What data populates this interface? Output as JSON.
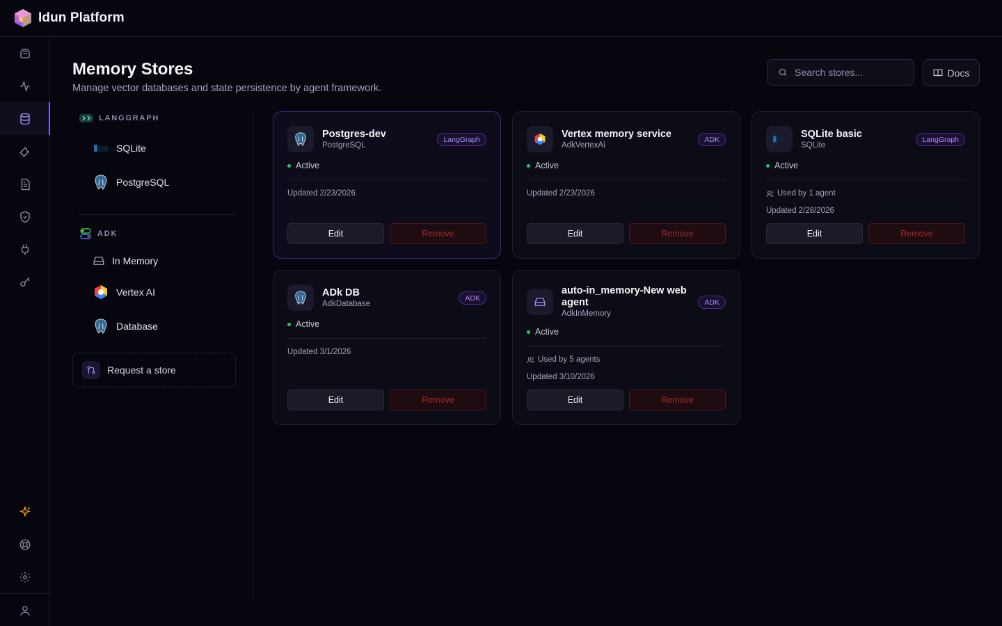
{
  "app": {
    "title": "Idun Platform"
  },
  "rail": {
    "items": [
      {
        "name": "agents-icon"
      },
      {
        "name": "activity-icon"
      },
      {
        "name": "database-icon",
        "active": true
      },
      {
        "name": "wrench-icon"
      },
      {
        "name": "document-icon"
      },
      {
        "name": "shield-icon"
      },
      {
        "name": "plug-icon"
      },
      {
        "name": "key-icon"
      }
    ],
    "bottom": [
      {
        "name": "sparkle-icon"
      },
      {
        "name": "help-icon"
      },
      {
        "name": "settings-icon"
      },
      {
        "name": "user-icon"
      }
    ]
  },
  "page": {
    "title": "Memory Stores",
    "subtitle": "Manage vector databases and state persistence by agent framework."
  },
  "search": {
    "placeholder": "Search stores..."
  },
  "docs": {
    "label": "Docs"
  },
  "frameworks": [
    {
      "label": "LANGGRAPH",
      "icon": "langgraph-icon",
      "items": [
        {
          "label": "SQLite",
          "icon": "sqlite-icon"
        },
        {
          "label": "PostgreSQL",
          "icon": "postgresql-icon"
        }
      ]
    },
    {
      "label": "ADK",
      "icon": "adk-icon",
      "items": [
        {
          "label": "In Memory",
          "icon": "memory-icon"
        },
        {
          "label": "Vertex AI",
          "icon": "vertex-ai-icon"
        },
        {
          "label": "Database",
          "icon": "database-elephant-icon"
        }
      ]
    }
  ],
  "request": {
    "label": "Request a store"
  },
  "cards": [
    {
      "title": "Postgres-dev",
      "subtitle": "PostgreSQL",
      "badge": "LangGraph",
      "status": "Active",
      "updated": "Updated 2/23/2026",
      "used_by": "",
      "icon": "postgresql-icon",
      "edit": "Edit",
      "remove": "Remove"
    },
    {
      "title": "Vertex memory service",
      "subtitle": "AdkVertexAi",
      "badge": "ADK",
      "status": "Active",
      "updated": "Updated 2/23/2026",
      "used_by": "",
      "icon": "vertex-ai-icon",
      "edit": "Edit",
      "remove": "Remove"
    },
    {
      "title": "SQLite basic",
      "subtitle": "SQLite",
      "badge": "LangGraph",
      "status": "Active",
      "updated": "Updated 2/28/2026",
      "used_by": "Used by 1 agent",
      "icon": "sqlite-icon",
      "edit": "Edit",
      "remove": "Remove"
    },
    {
      "title": "ADk DB",
      "subtitle": "AdkDatabase",
      "badge": "ADK",
      "status": "Active",
      "updated": "Updated 3/1/2026",
      "used_by": "",
      "icon": "postgresql-icon",
      "edit": "Edit",
      "remove": "Remove"
    },
    {
      "title": "auto-in_memory-New web agent",
      "subtitle": "AdkInMemory",
      "badge": "ADK",
      "status": "Active",
      "updated": "Updated 3/10/2026",
      "used_by": "Used by 5 agents",
      "icon": "memory-icon",
      "edit": "Edit",
      "remove": "Remove"
    }
  ],
  "colors": {
    "accent": "#8b5cf6",
    "active_dot": "#22c55e",
    "remove_text": "#9d2a2e",
    "background": "#06060f"
  }
}
